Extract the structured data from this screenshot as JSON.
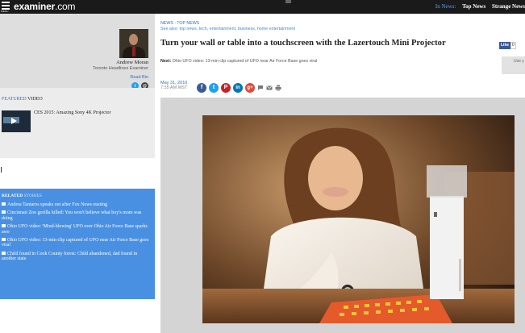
{
  "topbar": {
    "menu_label": "MENU",
    "logo_main": "examiner",
    "logo_suffix": ".com",
    "in_news": "In News:",
    "nav": [
      "Top News",
      "Strange News"
    ]
  },
  "author": {
    "name": "Andrew Moran",
    "title": "Toronto Headlines Examiner",
    "read_bio": "Read Bio",
    "social_icons": [
      "twitter-icon",
      "email-icon"
    ]
  },
  "featured": {
    "heading_highlight": "FEATURED",
    "heading_rest": " VIDEO",
    "title": "CES 2015: Amazing Sony 4K Projector"
  },
  "related": {
    "heading_bold": "RELATED",
    "heading_light": " STORIES",
    "items": [
      "Andrea Tantaros speaks out after Fox News ousting",
      "Cincinnati Zoo gorilla killed: You won't believe what boy's mom was doing",
      "Ohio UFO video: 'Mind-blowing' UFO over Ohio Air Force Base sparks awe",
      "Ohio UFO video: 13-min clip captured of UFO near Air Force Base goes viral",
      "Child found in Cook County forest: Child abandoned, dad found in another state"
    ]
  },
  "article": {
    "breadcrumb": "NEWS : TOP NEWS",
    "see_also": "See also: top news, tech, entertainment, business, home entertainment",
    "headline": "Turn your wall or table into a touchscreen with the Lazertouch Mini Projector",
    "fb_like": "Like",
    "fb_count": "0",
    "next_label": "Next:",
    "next_text": " Ohio UFO video: 13-min clip captured of UFO near Air Force Base goes viral",
    "use_box": "Use y",
    "date": "May 31, 2016",
    "time": "7:55 AM MST",
    "share_icons": [
      "facebook-icon",
      "twitter-icon",
      "pinterest-icon",
      "linkedin-icon",
      "google-plus-icon",
      "comment-icon",
      "email-icon",
      "print-icon"
    ]
  },
  "colors": {
    "topbar": "#1a1a1a",
    "link_blue": "#2a72c8",
    "related_bg": "#4a90e2",
    "facebook": "#3b5998",
    "twitter": "#1da1f2",
    "pinterest": "#cb2027",
    "linkedin": "#0077b5",
    "google_plus": "#dd4b39"
  }
}
